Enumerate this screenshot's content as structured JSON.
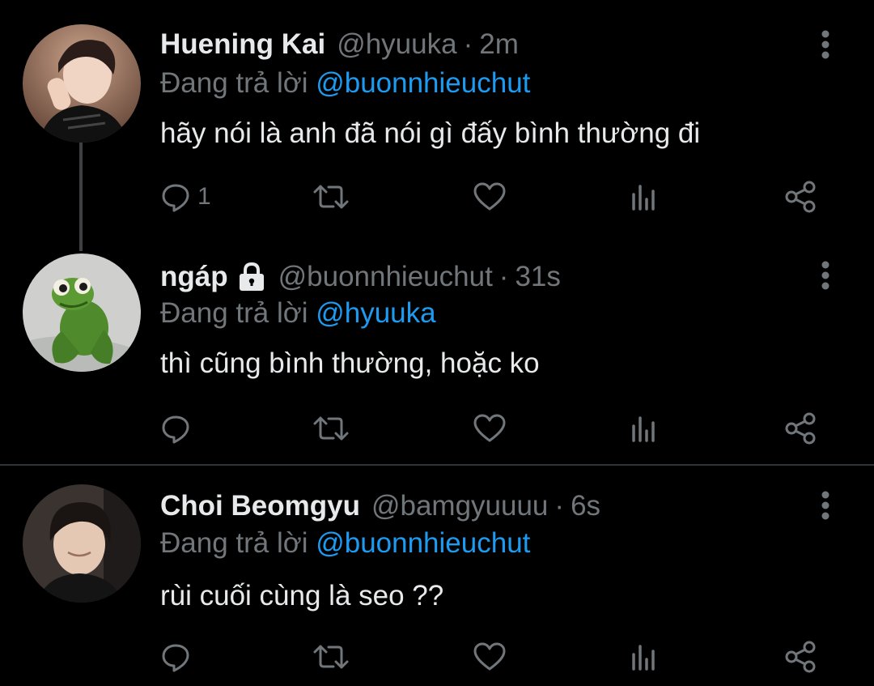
{
  "colors": {
    "background": "#000000",
    "text": "#e7e9ea",
    "secondary_text": "#71767b",
    "accent": "#1d9bf0",
    "thread_line": "#3e4144"
  },
  "tweets": [
    {
      "name": "Huening Kai",
      "handle": "@hyuuka",
      "separator": "·",
      "time": "2m",
      "locked": false,
      "reply_prefix": "Đang trả lời",
      "reply_to": "@buonnhieuchut",
      "text": "hãy nói là anh đã nói gì đấy bình thường đi",
      "reply_count": "1",
      "avatar": "portrait-photo"
    },
    {
      "name": "ngáp",
      "handle": "@buonnhieuchut",
      "separator": "·",
      "time": "31s",
      "locked": true,
      "reply_prefix": "Đang trả lời",
      "reply_to": "@hyuuka",
      "text": "thì cũng bình thường, hoặc ko",
      "reply_count": "",
      "avatar": "green-frog-plush-photo"
    },
    {
      "name": "Choi Beomgyu",
      "handle": "@bamgyuuuu",
      "separator": "·",
      "time": "6s",
      "locked": false,
      "reply_prefix": "Đang trả lời",
      "reply_to": "@buonnhieuchut",
      "text": "rùi cuối cùng là seo ??",
      "reply_count": "",
      "avatar": "portrait-photo"
    }
  ],
  "icons": {
    "more": "more-vertical-icon",
    "reply": "reply-bubble-icon",
    "retweet": "retweet-icon",
    "like": "heart-icon",
    "views": "analytics-icon",
    "share": "share-icon",
    "lock": "lock-icon"
  }
}
